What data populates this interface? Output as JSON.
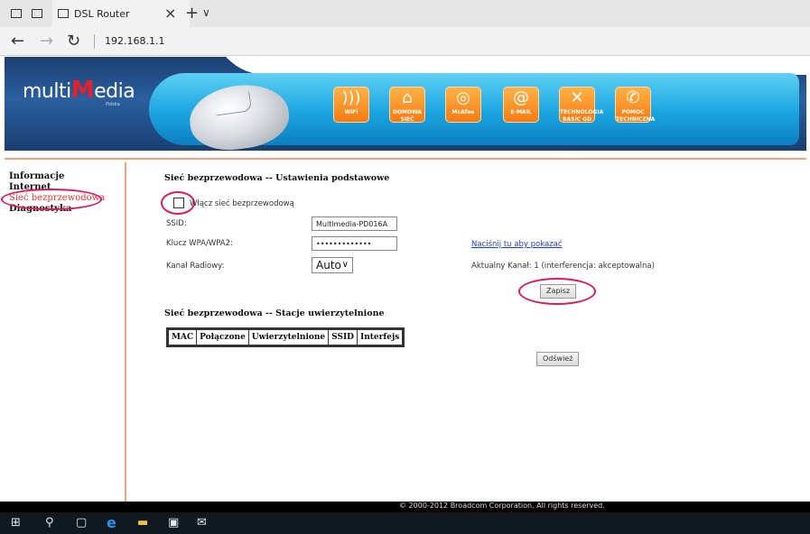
{
  "browser": {
    "tab_title": "DSL Router",
    "address": "192.168.1.1",
    "new_tab_symbol": "+",
    "tab_menu_symbol": "∨",
    "close_symbol": "×",
    "back_symbol": "←",
    "forward_symbol": "→",
    "refresh_symbol": "↻"
  },
  "banner": {
    "logo_pre": "multi",
    "logo_m": "M",
    "logo_post": "edia",
    "logo_sub": "Polska",
    "services": [
      {
        "label": "WiFi",
        "icon": "wifi-icon",
        "glyph": ")))"
      },
      {
        "label": "DOMOWA SIEĆ",
        "icon": "home-network-icon",
        "glyph": "⌂"
      },
      {
        "label": "McAfee",
        "icon": "mcafee-icon",
        "glyph": "◎"
      },
      {
        "label": "E-MAIL",
        "icon": "email-icon",
        "glyph": "@"
      },
      {
        "label": "TECHNOLOGIA BASIC GD",
        "icon": "technology-icon",
        "glyph": "✕"
      },
      {
        "label": "POMOC TECHNICZNA",
        "icon": "support-icon",
        "glyph": "✆"
      }
    ]
  },
  "leftnav": {
    "items": [
      {
        "label": "Informacje"
      },
      {
        "label": "Internet"
      },
      {
        "label": "Sieć bezprzewodowa"
      },
      {
        "label": "Diagnostyka"
      }
    ]
  },
  "content": {
    "basic_title": "Sieć bezprzewodowa -- Ustawienia podstawowe",
    "enable_label": "Włącz sieć bezprzewodową",
    "ssid_label": "SSID:",
    "ssid_value": "Multimedia-PD016A",
    "key_label": "Klucz WPA/WPA2:",
    "key_value": "•••••••••••••",
    "show_link": "Naciśnij tu aby pokazać",
    "channel_label": "Kanał Radiowy:",
    "channel_value": "Auto",
    "channel_status": "Aktualny Kanał: 1 (interferencja: akceptowalna)",
    "save_button": "Zapisz",
    "stations_title": "Sieć bezprzewodowa -- Stacje uwierzytelnione",
    "table_headers": [
      "MAC",
      "Połączone",
      "Uwierzytelnione",
      "SSID",
      "Interfejs"
    ],
    "refresh_button": "Odśwież"
  },
  "footer": {
    "copyright": "© 2000-2012 Broadcom Corporation. All rights reserved."
  },
  "colors": {
    "annotation": "#e0175c",
    "accent_orange": "#f57a10",
    "banner_blue": "#1c3f73",
    "banner_cyan": "#1aa5e0"
  }
}
